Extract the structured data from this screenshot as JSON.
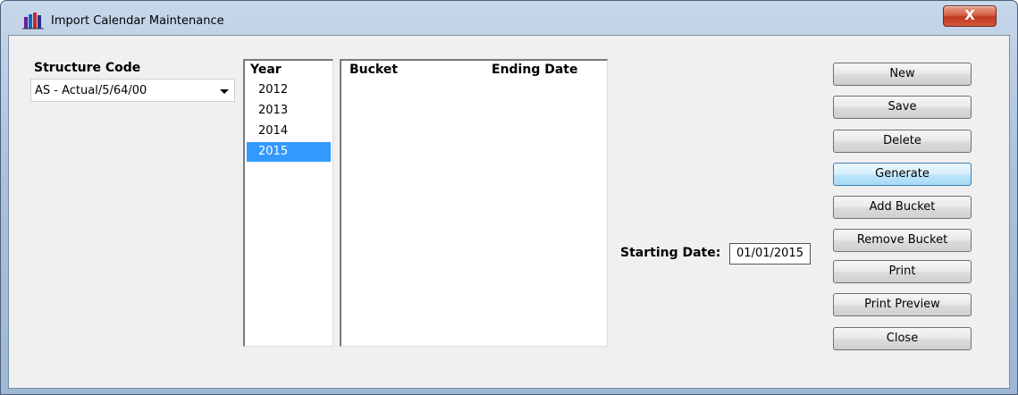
{
  "window": {
    "title": "Import Calendar Maintenance",
    "close_label": "X"
  },
  "structure": {
    "label": "Structure Code",
    "selected": "AS - Actual/5/64/00"
  },
  "year_list": {
    "header": "Year",
    "items": [
      "2012",
      "2013",
      "2014",
      "2015"
    ],
    "selected": "2015"
  },
  "bucket_list": {
    "headers": [
      "Bucket",
      "Ending Date"
    ],
    "rows": []
  },
  "starting_date": {
    "label": "Starting Date:",
    "value": "01/01/2015"
  },
  "buttons": {
    "new": "New",
    "save": "Save",
    "delete": "Delete",
    "generate": "Generate",
    "add_bucket": "Add Bucket",
    "remove_bucket": "Remove Bucket",
    "print": "Print",
    "print_preview": "Print Preview",
    "close": "Close"
  },
  "colors": {
    "selection": "#3399ff",
    "titlebar": "#a9c1de",
    "close_button": "#c2391f"
  },
  "icons": {
    "app": "books-icon",
    "dropdown": "chevron-down-icon"
  }
}
